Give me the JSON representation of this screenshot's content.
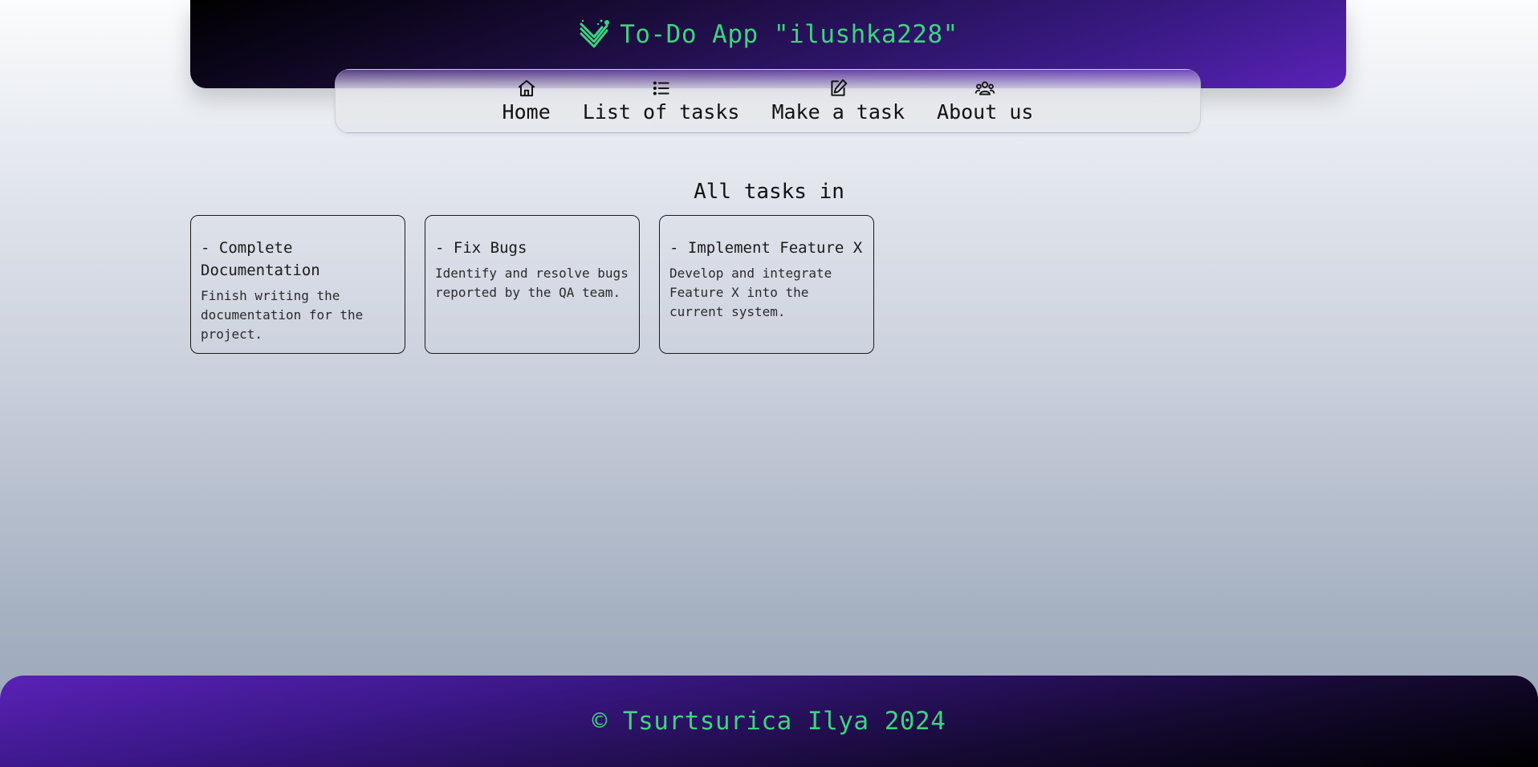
{
  "header": {
    "logo_icon": "double-check-icon",
    "title": "To-Do App \"ilushka228\"",
    "accent_color": "#3fd37e"
  },
  "nav": {
    "items": [
      {
        "label": "Home",
        "icon": "home-icon"
      },
      {
        "label": "List of tasks",
        "icon": "list-icon"
      },
      {
        "label": "Make a task",
        "icon": "edit-icon"
      },
      {
        "label": "About us",
        "icon": "users-icon"
      }
    ]
  },
  "main": {
    "section_title": "All tasks in",
    "tasks": [
      {
        "title": "- Complete Documentation",
        "description": "Finish writing the documentation for the project."
      },
      {
        "title": "- Fix Bugs",
        "description": "Identify and resolve bugs reported by the QA team."
      },
      {
        "title": "- Implement Feature X",
        "description": "Develop and integrate Feature X into the current system."
      }
    ]
  },
  "footer": {
    "copyright": "© Tsurtsurica Ilya 2024"
  }
}
